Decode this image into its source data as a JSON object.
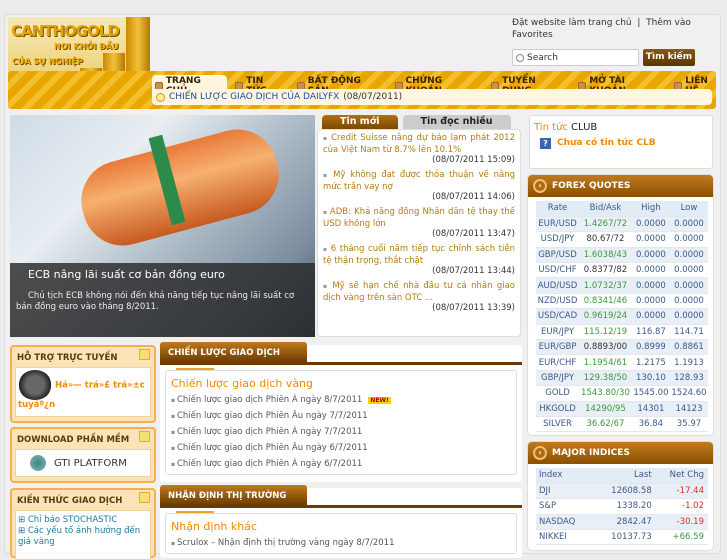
{
  "logo": {
    "brand": "CANTHOGOLD",
    "slogan1": "NƠI KHỞI ĐẦU",
    "slogan2": "CỦA SỰ NGHIỆP"
  },
  "top_links": {
    "homepage": "Đặt website làm trang chủ",
    "sep": "|",
    "favorites": "Thêm vào Favorites"
  },
  "search": {
    "placeholder": "Search",
    "button": "Tìm kiếm"
  },
  "nav": [
    "TRANG CHỦ",
    "TIN TỨC",
    "BẤT ĐỘNG SẢN",
    "CHỨNG KHOÁN",
    "TUYỂN DỤNG",
    "MỞ TÀI KHOẢN",
    "LIÊN HỆ"
  ],
  "ticker": {
    "title": "CHIẾN LƯỢC GIAO DỊCH CỦA DAILYFX",
    "date": "(08/07/2011)"
  },
  "slider": {
    "title": "ECB nâng lãi suất cơ bản đồng euro",
    "desc": "Chủ tịch ECB không nói đến khả năng tiếp tục nâng lãi suất cơ bản đồng euro vào tháng 8/2011."
  },
  "news_tabs": [
    "Tin mới",
    "Tin đọc nhiều"
  ],
  "news": [
    {
      "title": "Credit Suisse nâng dự báo lạm phát 2012 của Việt Nam từ 8.7% lên 10.1%",
      "date": "(08/07/2011 15:09)"
    },
    {
      "title": "Mỹ không đạt được thỏa thuận về nâng mức trần vay nợ",
      "date": "(08/07/2011 14:06)"
    },
    {
      "title": "ADB: Khả năng đồng Nhân dân tệ thay thế USD không lớn",
      "date": "(08/07/2011 13:47)"
    },
    {
      "title": "6 tháng cuối năm tiếp tục chính sách tiền tệ thận trọng, thắt chặt",
      "date": "(08/07/2011 13:44)"
    },
    {
      "title": "Mỹ sẽ hạn chế nhà đầu tư cá nhân giao dịch vàng trên sàn OTC ...",
      "date": "(08/07/2011 13:39)"
    }
  ],
  "club": {
    "title_a": "Tin tức",
    "title_b": "CLUB",
    "empty": "Chưa có tin tức CLB"
  },
  "forex": {
    "title": "FOREX QUOTES",
    "headers": [
      "Rate",
      "Bid/Ask",
      "High",
      "Low"
    ],
    "rows": [
      [
        "EUR/USD",
        "1.4267/72",
        "0.0000",
        "0.0000",
        "up"
      ],
      [
        "USD/JPY",
        "80.67/72",
        "0.0000",
        "0.0000",
        "flat"
      ],
      [
        "GBP/USD",
        "1.6038/43",
        "0.0000",
        "0.0000",
        "up"
      ],
      [
        "USD/CHF",
        "0.8377/82",
        "0.0000",
        "0.0000",
        "flat"
      ],
      [
        "AUD/USD",
        "1.0732/37",
        "0.0000",
        "0.0000",
        "up"
      ],
      [
        "NZD/USD",
        "0.8341/46",
        "0.0000",
        "0.0000",
        "up"
      ],
      [
        "USD/CAD",
        "0.9619/24",
        "0.0000",
        "0.0000",
        "up"
      ],
      [
        "EUR/JPY",
        "115.12/19",
        "116.87",
        "114.71",
        "up"
      ],
      [
        "EUR/GBP",
        "0.8893/00",
        "0.8999",
        "0.8861",
        "flat"
      ],
      [
        "EUR/CHF",
        "1.1954/61",
        "1.2175",
        "1.1913",
        "up"
      ],
      [
        "GBP/JPY",
        "129.38/50",
        "130.10",
        "128.93",
        "up"
      ],
      [
        "GOLD",
        "1543.80/30",
        "1545.00",
        "1524.60",
        "up"
      ],
      [
        "HKGOLD",
        "14290/95",
        "14301",
        "14123",
        "up"
      ],
      [
        "SILVER",
        "36.62/67",
        "36.84",
        "35.97",
        "up"
      ]
    ]
  },
  "indices": {
    "title": "MAJOR INDICES",
    "headers": [
      "Index",
      "Last",
      "Net Chg"
    ],
    "rows": [
      [
        "DJI",
        "12608.58",
        "-17.44",
        "dn"
      ],
      [
        "S&P",
        "1338.20",
        "-1.02",
        "dn"
      ],
      [
        "NASDAQ",
        "2842.47",
        "-30.19",
        "dn"
      ],
      [
        "NIKKEI",
        "10137.73",
        "+66.59",
        "up"
      ]
    ]
  },
  "support": {
    "title": "HỖ TRỢ TRỰC TUYẾN",
    "text": "Há»— trá»£ trá»±c tuyáº¿n"
  },
  "download": {
    "title": "DOWNLOAD PHẦN MỀM",
    "label": "GTI PLATFORM"
  },
  "knowledge": {
    "title": "KIẾN THỨC GIAO DỊCH",
    "items": [
      "Chỉ báo STOCHASTIC",
      "Các yếu tố ảnh hưởng đến giá vàng"
    ]
  },
  "strategy": {
    "tab": "CHIẾN LƯỢC GIAO DỊCH",
    "heading": "Chiến lược giao dịch vàng",
    "new_badge": "NEW!",
    "items": [
      "Chiến lược giao dịch Phiên Á ngày 8/7/2011",
      "Chiến lược giao dịch Phiên Âu ngày 7/7/2011",
      "Chiến lược giao dịch Phiên Á ngày 7/7/2011",
      "Chiến lược giao dịch Phiên Âu ngày 6/7/2011",
      "Chiến lược giao dịch Phiên Á ngày 6/7/2011"
    ]
  },
  "analysis": {
    "tab": "NHẬN ĐỊNH THỊ TRƯỜNG",
    "heading": "Nhận định khác",
    "items": [
      "Scrulox – Nhận định thị trường vàng ngày 8/7/2011"
    ]
  }
}
